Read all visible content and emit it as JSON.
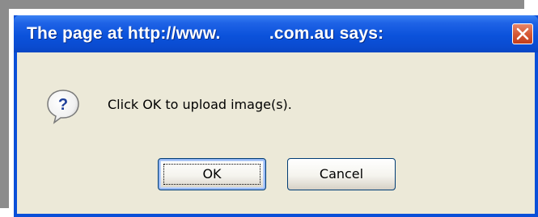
{
  "dialog": {
    "title": "The page at http://www.          .com.au says:",
    "message": "Click OK to upload image(s).",
    "icon": "question-icon",
    "close_icon": "close-icon",
    "buttons": {
      "ok_label": "OK",
      "cancel_label": "Cancel"
    }
  },
  "colors": {
    "titlebar": "#0a4fd8",
    "close_button": "#d75a36",
    "client_background": "#ece9d8",
    "button_border": "#003c74"
  }
}
